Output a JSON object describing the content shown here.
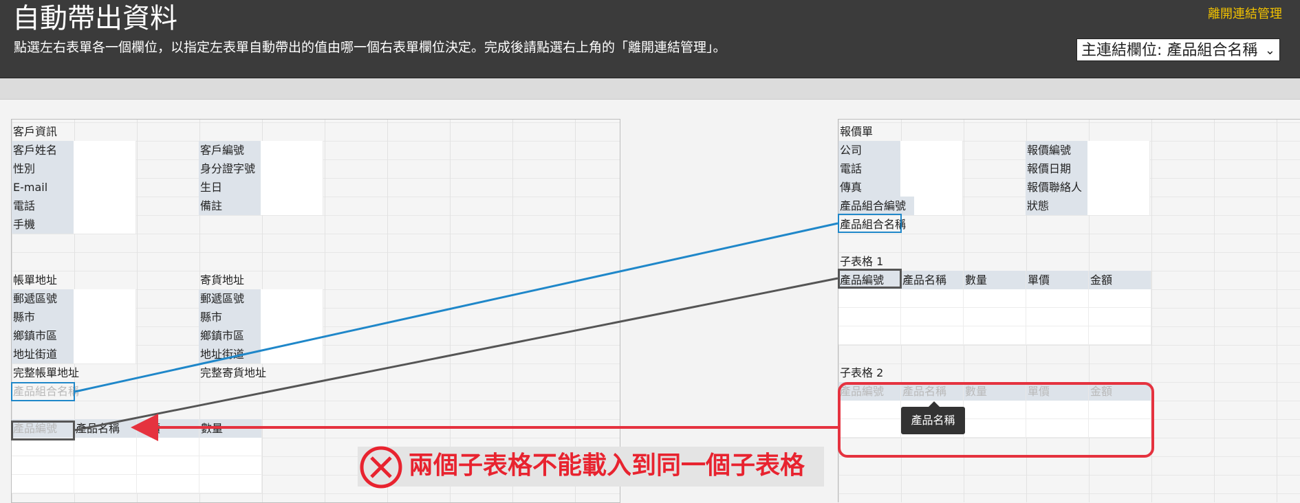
{
  "header": {
    "title": "自動帶出資料",
    "subtitle": "點選左右表單各一個欄位，以指定左表單自動帶出的值由哪一個右表單欄位決定。完成後請點選右上角的「離開連結管理」。",
    "leave_link": "離開連結管理",
    "key_field_select": "主連結欄位: 產品組合名稱"
  },
  "left_form": {
    "section_customer": "客戶資訊",
    "customer_rows": [
      [
        "客戶姓名",
        "客戶編號"
      ],
      [
        "性別",
        "身分證字號"
      ],
      [
        "E-mail",
        "生日"
      ],
      [
        "電話",
        "備註"
      ],
      [
        "手機",
        ""
      ]
    ],
    "billing_header": "帳單地址",
    "shipping_header": "寄貨地址",
    "address_rows": [
      [
        "郵遞區號",
        "郵遞區號"
      ],
      [
        "縣市",
        "縣市"
      ],
      [
        "鄉鎮市區",
        "鄉鎮市區"
      ],
      [
        "地址街道",
        "地址街道"
      ]
    ],
    "full_billing": "完整帳單地址",
    "full_shipping": "完整寄貨地址",
    "product_combo_name": "產品組合名稱",
    "subtable_headers": [
      "產品編號",
      "產品名稱",
      "單價",
      "數量"
    ]
  },
  "right_form": {
    "section_quote": "報價單",
    "quote_rows": [
      [
        "公司",
        "報價編號"
      ],
      [
        "電話",
        "報價日期"
      ],
      [
        "傳真",
        "報價聯絡人"
      ],
      [
        "產品組合編號",
        "狀態"
      ]
    ],
    "product_combo_name": "產品組合名稱",
    "subtable1_title": "子表格 1",
    "subtable1_headers": [
      "產品編號",
      "產品名稱",
      "數量",
      "單價",
      "金額"
    ],
    "subtable2_title": "子表格 2",
    "subtable2_headers": [
      "產品編號",
      "產品名稱",
      "數量",
      "單價",
      "金額"
    ]
  },
  "tooltip": "產品名稱",
  "warning": "兩個子表格不能載入到同一個子表格",
  "colors": {
    "header_bg": "#3b3b3b",
    "link_yellow": "#f2c200",
    "blue_link": "#1f87c9",
    "grey_link": "#555555",
    "error_red": "#e5323f"
  },
  "icons": {
    "warning": "circle-x-icon",
    "dropdown": "chevron-down-icon"
  }
}
